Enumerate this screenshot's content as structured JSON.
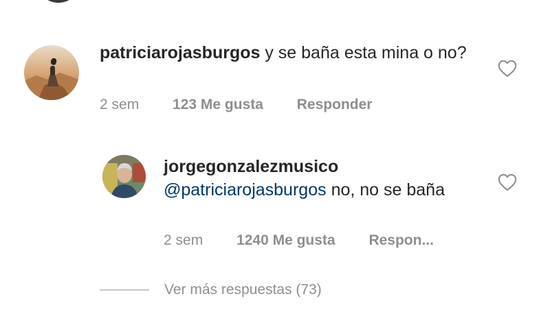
{
  "comment": {
    "username": "patriciarojasburgos",
    "text": "y se baña esta mina o no?",
    "time": "2 sem",
    "likes": "123 Me gusta",
    "reply_label": "Responder",
    "like_icon": "heart-outline-icon"
  },
  "reply": {
    "username": "jorgegonzalezmusico",
    "mention": "@patriciarojasburgos",
    "text": "no, no se baña",
    "time": "2 sem",
    "likes": "1240 Me gusta",
    "reply_label": "Respon...",
    "like_icon": "heart-outline-icon"
  },
  "view_more": {
    "label": "Ver más respuestas (73)"
  },
  "colors": {
    "text": "#262626",
    "secondary": "#8e8e8e",
    "mention": "#00376b"
  }
}
